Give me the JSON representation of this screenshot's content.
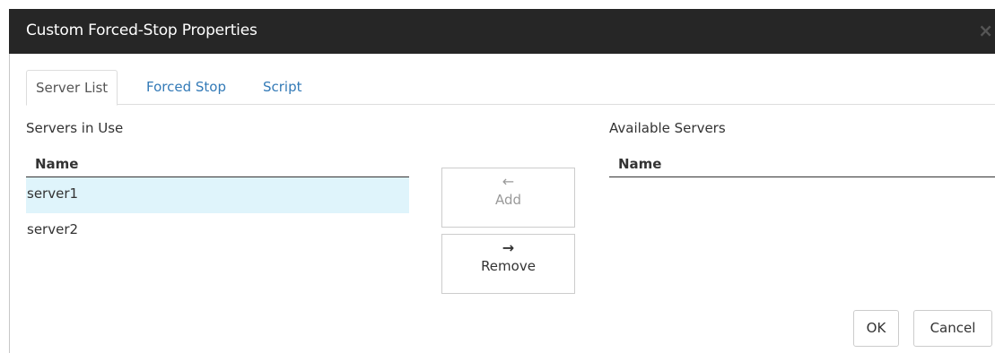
{
  "dialog": {
    "title": "Custom Forced-Stop Properties",
    "close_glyph": "×"
  },
  "tabs": [
    {
      "label": "Server List",
      "active": true
    },
    {
      "label": "Forced Stop",
      "active": false
    },
    {
      "label": "Script",
      "active": false
    }
  ],
  "servers_in_use": {
    "label": "Servers in Use",
    "column_header": "Name",
    "items": [
      {
        "name": "server1",
        "selected": true
      },
      {
        "name": "server2",
        "selected": false
      }
    ]
  },
  "available_servers": {
    "label": "Available Servers",
    "column_header": "Name",
    "items": []
  },
  "move_buttons": {
    "add": {
      "arrow": "🡐",
      "label": "Add",
      "enabled": false
    },
    "remove": {
      "arrow": "🡒",
      "label": "Remove",
      "enabled": true
    }
  },
  "footer": {
    "ok_label": "OK",
    "cancel_label": "Cancel"
  },
  "colors": {
    "titlebar": "#262626",
    "link": "#337ab7",
    "selected_row": "#dff4fb"
  }
}
